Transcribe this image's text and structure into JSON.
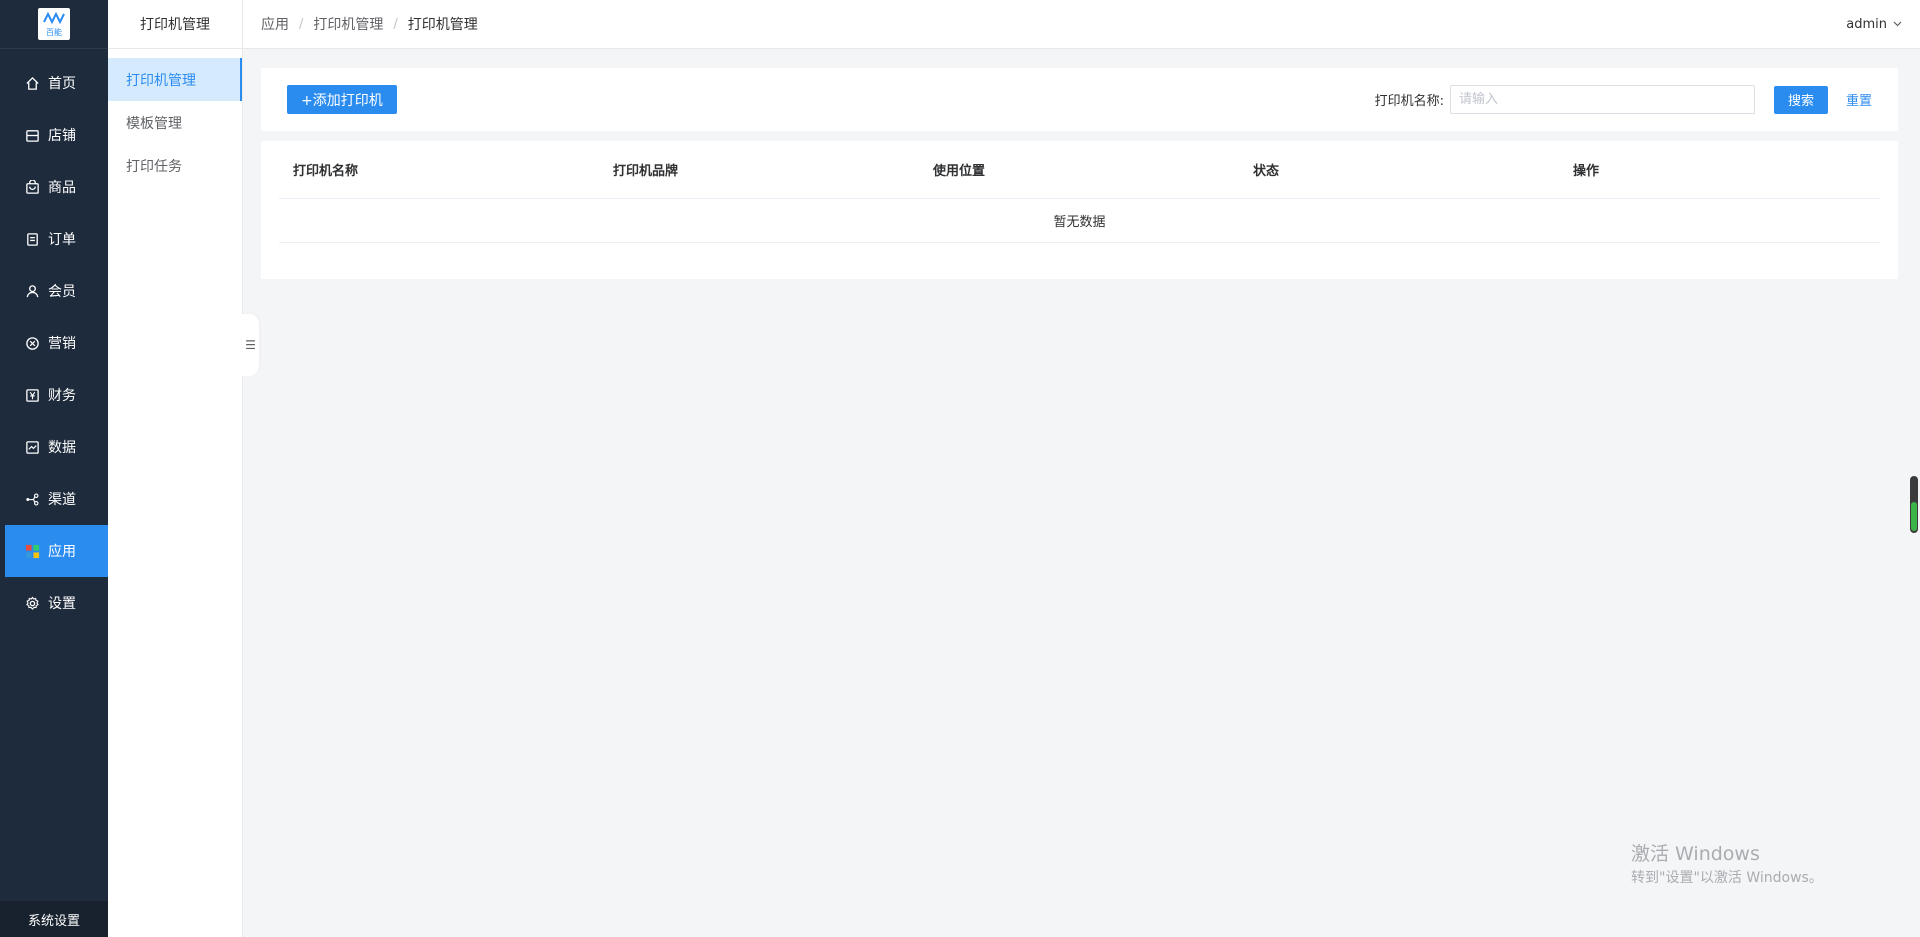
{
  "app": {
    "logo_text": "百能"
  },
  "nav": {
    "items": [
      {
        "label": "首页",
        "icon": "home-icon"
      },
      {
        "label": "店铺",
        "icon": "store-icon"
      },
      {
        "label": "商品",
        "icon": "bag-icon"
      },
      {
        "label": "订单",
        "icon": "order-icon"
      },
      {
        "label": "会员",
        "icon": "user-icon"
      },
      {
        "label": "营销",
        "icon": "marketing-icon"
      },
      {
        "label": "财务",
        "icon": "yen-icon"
      },
      {
        "label": "数据",
        "icon": "chart-icon"
      },
      {
        "label": "渠道",
        "icon": "channel-icon"
      },
      {
        "label": "应用",
        "icon": "apps-icon",
        "active": true
      },
      {
        "label": "设置",
        "icon": "gear-icon"
      }
    ],
    "system_settings": "系统设置"
  },
  "subnav": {
    "title": "打印机管理",
    "items": [
      {
        "label": "打印机管理",
        "active": true
      },
      {
        "label": "模板管理"
      },
      {
        "label": "打印任务"
      }
    ]
  },
  "header": {
    "breadcrumb": [
      "应用",
      "打印机管理",
      "打印机管理"
    ],
    "user": "admin"
  },
  "toolbar": {
    "add_label": "+添加打印机",
    "filter_label": "打印机名称:",
    "filter_placeholder": "请输入",
    "filter_value": "",
    "search_label": "搜索",
    "reset_label": "重置"
  },
  "table": {
    "columns": [
      "打印机名称",
      "打印机品牌",
      "使用位置",
      "状态",
      "操作"
    ],
    "rows": [],
    "empty_text": "暂无数据"
  },
  "watermark": {
    "line1": "激活 Windows",
    "line2": "转到\"设置\"以激活 Windows。"
  },
  "colors": {
    "sidebar_bg": "#1e2b3c",
    "accent": "#2b8cf0",
    "sub_active_bg": "#d6eafd",
    "page_bg": "#f4f5f7"
  }
}
